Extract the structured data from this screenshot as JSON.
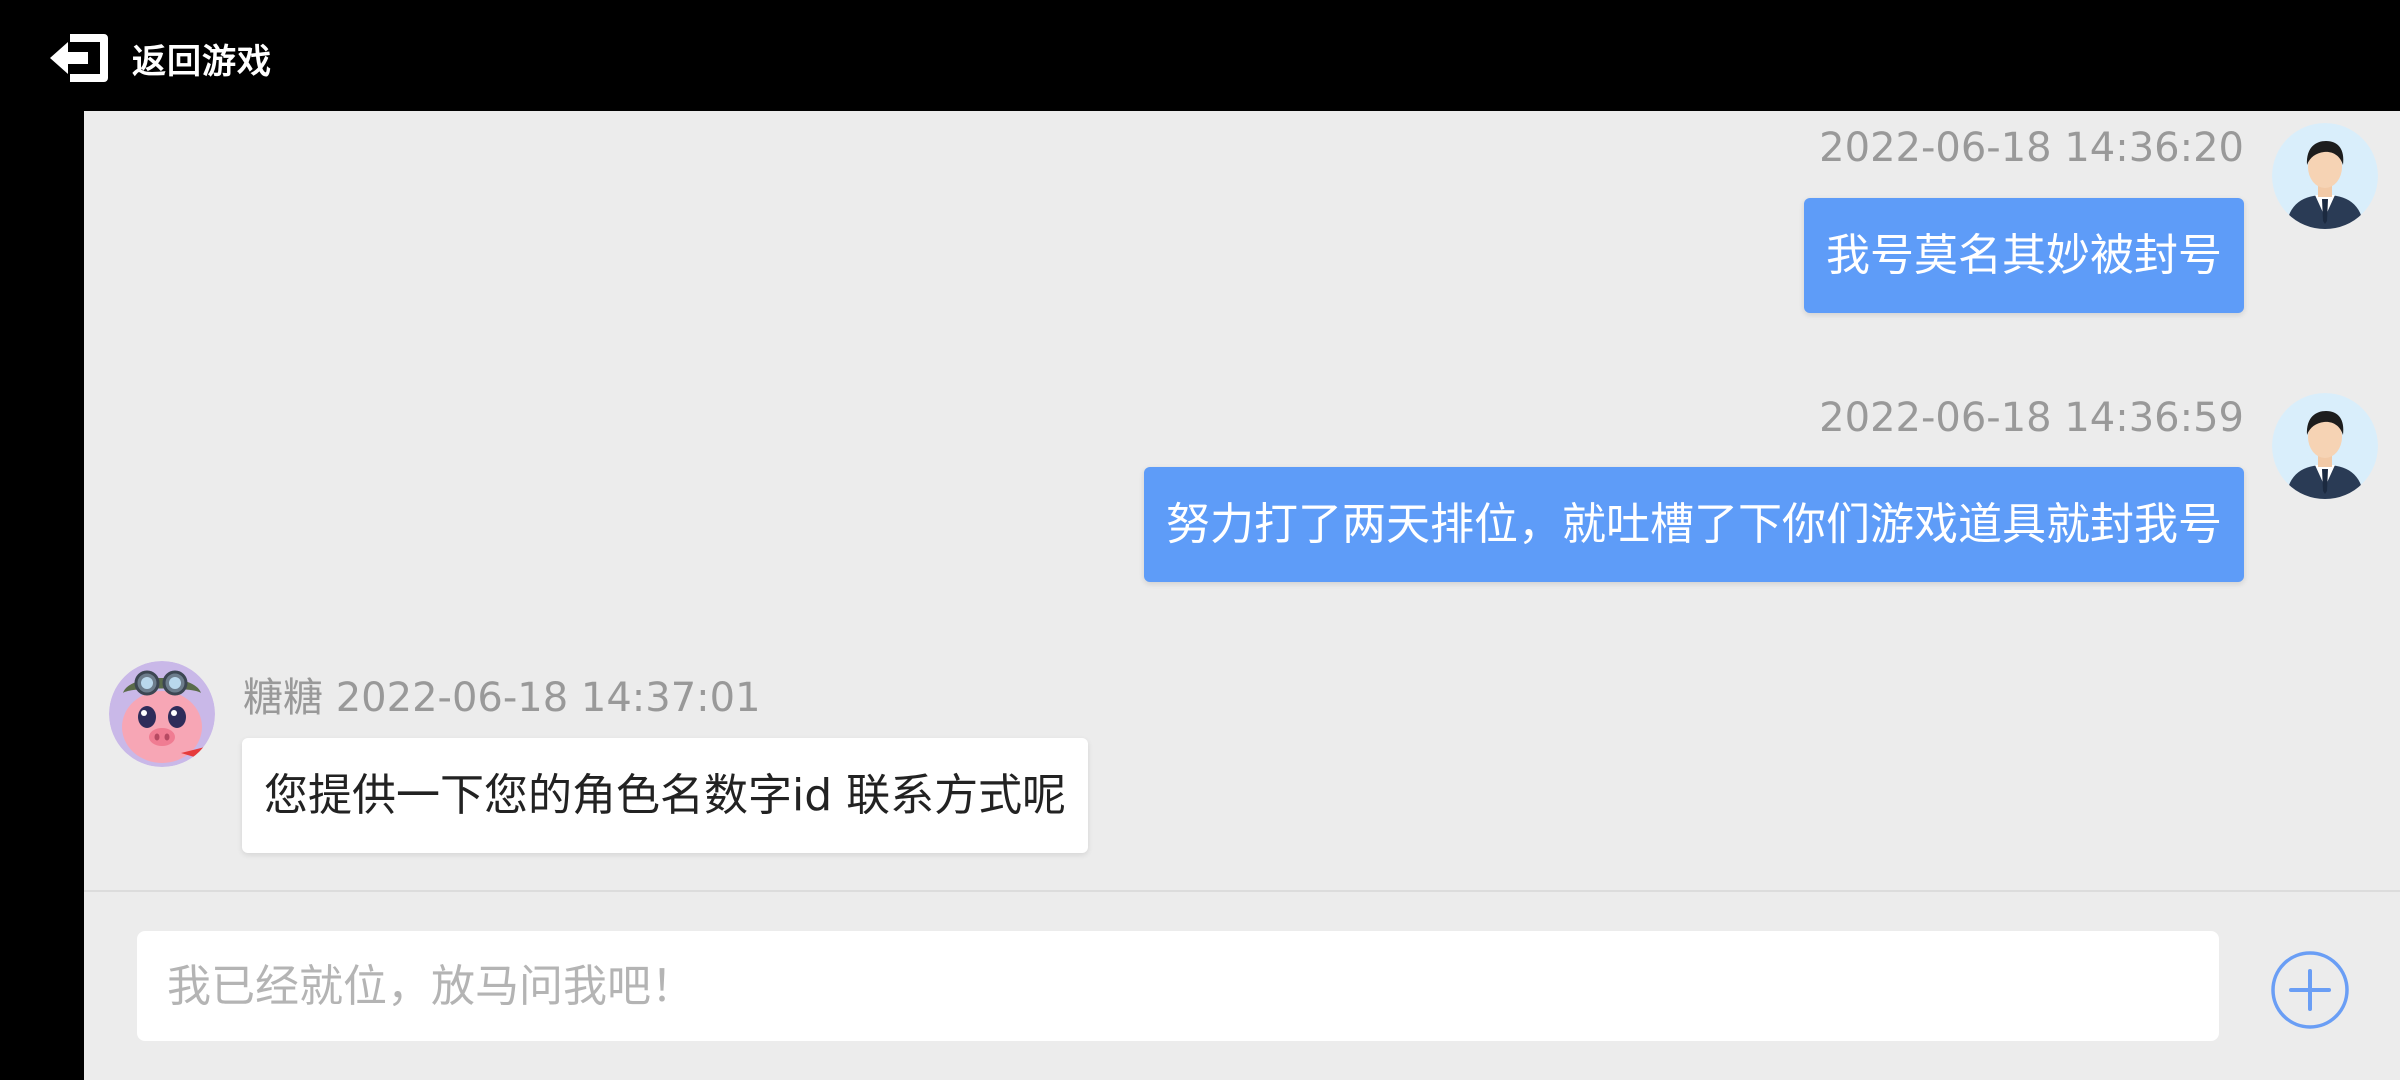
{
  "topbar": {
    "back_label": "返回游戏",
    "back_icon": "exit-arrow-icon"
  },
  "messages": [
    {
      "direction": "outgoing",
      "timestamp": "2022-06-18 14:36:20",
      "text": "我号莫名其妙被封号",
      "avatar": "businessman-avatar"
    },
    {
      "direction": "outgoing",
      "timestamp": "2022-06-18 14:36:59",
      "text": "努力打了两天排位，就吐槽了下你们游戏道具就封我号",
      "avatar": "businessman-avatar"
    },
    {
      "direction": "incoming",
      "sender": "糖糖",
      "timestamp": "2022-06-18 14:37:01",
      "text": "您提供一下您的角色名数字id 联系方式呢",
      "avatar": "cartoon-pig-avatar"
    }
  ],
  "composer": {
    "placeholder": "我已经就位，放马问我吧！",
    "value": "",
    "plus_icon": "plus-circle-icon"
  },
  "colors": {
    "outgoing_bubble": "#5e9cf8",
    "incoming_bubble": "#ffffff",
    "panel_background": "#ececec",
    "accent": "#5e9cf8"
  }
}
